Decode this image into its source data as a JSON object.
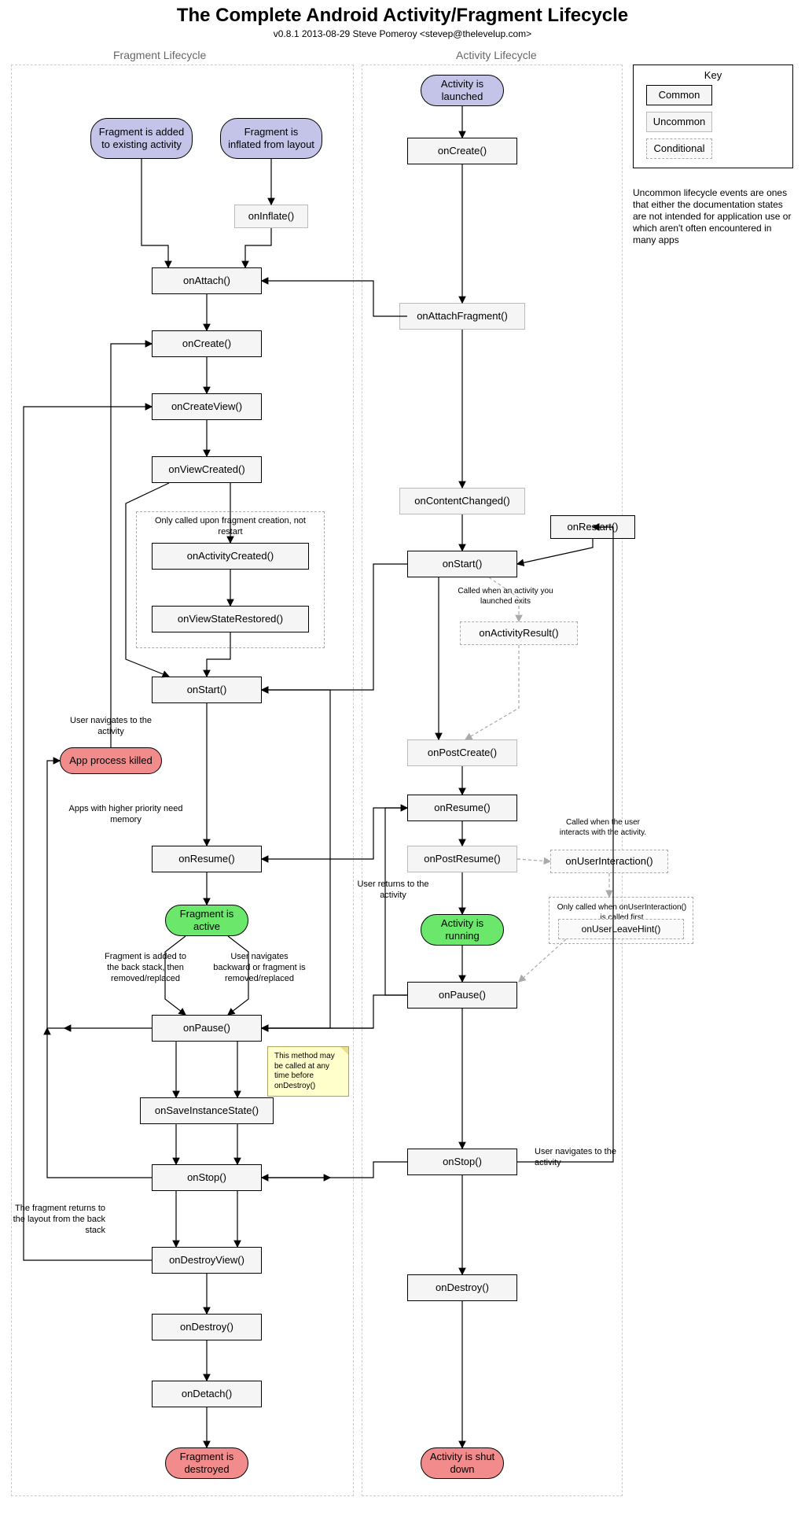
{
  "title": "The Complete Android Activity/Fragment Lifecycle",
  "subtitle": "v0.8.1 2013-08-29 Steve Pomeroy <stevep@thelevelup.com>",
  "regions": {
    "fragment": "Fragment Lifecycle",
    "activity": "Activity Lifecycle"
  },
  "key": {
    "title": "Key",
    "common": "Common",
    "uncommon": "Uncommon",
    "conditional": "Conditional",
    "note": "Uncommon lifecycle events are ones that either the documentation states are not intended for application use or which aren't often encountered in many apps"
  },
  "frag": {
    "added": "Fragment is added to existing activity",
    "inflated": "Fragment is inflated from layout",
    "onInflate": "onInflate()",
    "onAttach": "onAttach()",
    "onCreate": "onCreate()",
    "onCreateView": "onCreateView()",
    "onViewCreated": "onViewCreated()",
    "creationNote": "Only called upon fragment creation, not restart",
    "onActivityCreated": "onActivityCreated()",
    "onViewStateRestored": "onViewStateRestored()",
    "onStart": "onStart()",
    "navToActivity": "User navigates to the activity",
    "killed": "App process killed",
    "needMemory": "Apps with higher priority need memory",
    "onResume": "onResume()",
    "active": "Fragment is active",
    "pauseLeft": "Fragment is added to the back stack, then removed/replaced",
    "pauseRight": "User navigates backward or fragment is removed/replaced",
    "onPause": "onPause()",
    "onSaveInstanceState": "onSaveInstanceState()",
    "saveNote": "This method may be called at any time before onDestroy()",
    "onStop": "onStop()",
    "backStackNote": "The fragment returns to the layout from the back stack",
    "onDestroyView": "onDestroyView()",
    "onDestroy": "onDestroy()",
    "onDetach": "onDetach()",
    "destroyed": "Fragment is destroyed"
  },
  "act": {
    "launched": "Activity is launched",
    "onCreate": "onCreate()",
    "onAttachFragment": "onAttachFragment()",
    "onContentChanged": "onContentChanged()",
    "onRestart": "onRestart()",
    "onStart": "onStart()",
    "resultNote": "Called when an activity you launched exits",
    "onActivityResult": "onActivityResult()",
    "onPostCreate": "onPostCreate()",
    "onResume": "onResume()",
    "onPostResume": "onPostResume()",
    "userReturns": "User returns to the activity",
    "running": "Activity is running",
    "uiNote": "Called when the user interacts with the activity.",
    "onUserInteraction": "onUserInteraction()",
    "leaveNote": "Only called when onUserInteraction() is called first",
    "onUserLeaveHint": "onUserLeaveHint()",
    "onPause": "onPause()",
    "onStop": "onStop()",
    "stopNav": "User navigates to the activity",
    "onDestroy": "onDestroy()",
    "shutdown": "Activity is shut down"
  },
  "chart_data": {
    "type": "flowchart",
    "title": "The Complete Android Activity/Fragment Lifecycle",
    "lanes": [
      {
        "name": "Fragment Lifecycle"
      },
      {
        "name": "Activity Lifecycle"
      }
    ],
    "node_kinds": [
      "start",
      "common",
      "uncommon",
      "conditional",
      "running",
      "terminal"
    ],
    "nodes": [
      {
        "id": "f_added",
        "lane": 0,
        "kind": "start",
        "label": "Fragment is added to existing activity"
      },
      {
        "id": "f_inflated",
        "lane": 0,
        "kind": "start",
        "label": "Fragment is inflated from layout"
      },
      {
        "id": "f_onInflate",
        "lane": 0,
        "kind": "uncommon",
        "label": "onInflate()"
      },
      {
        "id": "f_onAttach",
        "lane": 0,
        "kind": "common",
        "label": "onAttach()"
      },
      {
        "id": "f_onCreate",
        "lane": 0,
        "kind": "common",
        "label": "onCreate()"
      },
      {
        "id": "f_onCreateView",
        "lane": 0,
        "kind": "common",
        "label": "onCreateView()"
      },
      {
        "id": "f_onViewCreated",
        "lane": 0,
        "kind": "common",
        "label": "onViewCreated()"
      },
      {
        "id": "f_onActivityCreated",
        "lane": 0,
        "kind": "common",
        "label": "onActivityCreated()",
        "group": "fragment_creation_only"
      },
      {
        "id": "f_onViewStateRestored",
        "lane": 0,
        "kind": "common",
        "label": "onViewStateRestored()",
        "group": "fragment_creation_only"
      },
      {
        "id": "f_onStart",
        "lane": 0,
        "kind": "common",
        "label": "onStart()"
      },
      {
        "id": "f_killed",
        "lane": 0,
        "kind": "terminal",
        "label": "App process killed"
      },
      {
        "id": "f_onResume",
        "lane": 0,
        "kind": "common",
        "label": "onResume()"
      },
      {
        "id": "f_active",
        "lane": 0,
        "kind": "running",
        "label": "Fragment is active"
      },
      {
        "id": "f_onPause",
        "lane": 0,
        "kind": "common",
        "label": "onPause()"
      },
      {
        "id": "f_onSave",
        "lane": 0,
        "kind": "common",
        "label": "onSaveInstanceState()"
      },
      {
        "id": "f_onStop",
        "lane": 0,
        "kind": "common",
        "label": "onStop()"
      },
      {
        "id": "f_onDestroyView",
        "lane": 0,
        "kind": "common",
        "label": "onDestroyView()"
      },
      {
        "id": "f_onDestroy",
        "lane": 0,
        "kind": "common",
        "label": "onDestroy()"
      },
      {
        "id": "f_onDetach",
        "lane": 0,
        "kind": "common",
        "label": "onDetach()"
      },
      {
        "id": "f_destroyed",
        "lane": 0,
        "kind": "terminal",
        "label": "Fragment is destroyed"
      },
      {
        "id": "a_launched",
        "lane": 1,
        "kind": "start",
        "label": "Activity is launched"
      },
      {
        "id": "a_onCreate",
        "lane": 1,
        "kind": "common",
        "label": "onCreate()"
      },
      {
        "id": "a_onAttachFragment",
        "lane": 1,
        "kind": "uncommon",
        "label": "onAttachFragment()"
      },
      {
        "id": "a_onContentChanged",
        "lane": 1,
        "kind": "uncommon",
        "label": "onContentChanged()"
      },
      {
        "id": "a_onRestart",
        "lane": 1,
        "kind": "common",
        "label": "onRestart()"
      },
      {
        "id": "a_onStart",
        "lane": 1,
        "kind": "common",
        "label": "onStart()"
      },
      {
        "id": "a_onActivityResult",
        "lane": 1,
        "kind": "conditional",
        "label": "onActivityResult()",
        "note": "Called when an activity you launched exits"
      },
      {
        "id": "a_onPostCreate",
        "lane": 1,
        "kind": "uncommon",
        "label": "onPostCreate()"
      },
      {
        "id": "a_onResume",
        "lane": 1,
        "kind": "common",
        "label": "onResume()"
      },
      {
        "id": "a_onPostResume",
        "lane": 1,
        "kind": "uncommon",
        "label": "onPostResume()"
      },
      {
        "id": "a_running",
        "lane": 1,
        "kind": "running",
        "label": "Activity is running"
      },
      {
        "id": "a_onUserInteraction",
        "lane": 1,
        "kind": "conditional",
        "label": "onUserInteraction()",
        "note": "Called when the user interacts with the activity."
      },
      {
        "id": "a_onUserLeaveHint",
        "lane": 1,
        "kind": "conditional",
        "label": "onUserLeaveHint()",
        "note": "Only called when onUserInteraction() is called first"
      },
      {
        "id": "a_onPause",
        "lane": 1,
        "kind": "common",
        "label": "onPause()"
      },
      {
        "id": "a_onStop",
        "lane": 1,
        "kind": "common",
        "label": "onStop()"
      },
      {
        "id": "a_onDestroy",
        "lane": 1,
        "kind": "common",
        "label": "onDestroy()"
      },
      {
        "id": "a_shutdown",
        "lane": 1,
        "kind": "terminal",
        "label": "Activity is shut down"
      }
    ],
    "groups": [
      {
        "id": "fragment_creation_only",
        "label": "Only called upon fragment creation, not restart"
      }
    ],
    "edges": [
      {
        "from": "f_added",
        "to": "f_onAttach"
      },
      {
        "from": "f_inflated",
        "to": "f_onInflate"
      },
      {
        "from": "f_onInflate",
        "to": "f_onAttach"
      },
      {
        "from": "f_onAttach",
        "to": "f_onCreate"
      },
      {
        "from": "f_onAttach",
        "to": "a_onAttachFragment"
      },
      {
        "from": "f_onCreate",
        "to": "f_onCreateView"
      },
      {
        "from": "f_onCreateView",
        "to": "f_onViewCreated"
      },
      {
        "from": "f_onViewCreated",
        "to": "f_onActivityCreated"
      },
      {
        "from": "f_onViewCreated",
        "to": "f_onStart",
        "bypass": true
      },
      {
        "from": "f_onActivityCreated",
        "to": "f_onViewStateRestored"
      },
      {
        "from": "f_onViewStateRestored",
        "to": "f_onStart"
      },
      {
        "from": "f_onStart",
        "to": "f_onResume"
      },
      {
        "from": "f_killed",
        "to": "f_onCreate",
        "label": "User navigates to the activity"
      },
      {
        "from": "f_onPause",
        "to": "f_killed",
        "label": "Apps with higher priority need memory"
      },
      {
        "from": "f_onStop",
        "to": "f_killed"
      },
      {
        "from": "f_onResume",
        "to": "f_active"
      },
      {
        "from": "f_active",
        "to": "f_onPause",
        "label_left": "Fragment is added to the back stack, then removed/replaced",
        "label_right": "User navigates backward or fragment is removed/replaced"
      },
      {
        "from": "f_onPause",
        "to": "f_onSave"
      },
      {
        "from": "f_onPause",
        "to": "f_onStart",
        "back": true
      },
      {
        "from": "f_onSave",
        "to": "f_onStop"
      },
      {
        "from": "f_onStop",
        "to": "f_onDestroyView"
      },
      {
        "from": "f_onStop",
        "to": "f_onStart",
        "back": true
      },
      {
        "from": "f_onDestroyView",
        "to": "f_onCreateView",
        "back": true,
        "label": "The fragment returns to the layout from the back stack"
      },
      {
        "from": "f_onDestroyView",
        "to": "f_onDestroy"
      },
      {
        "from": "f_onDestroy",
        "to": "f_onDetach"
      },
      {
        "from": "f_onDetach",
        "to": "f_destroyed"
      },
      {
        "from": "a_launched",
        "to": "a_onCreate"
      },
      {
        "from": "a_onCreate",
        "to": "a_onAttachFragment"
      },
      {
        "from": "a_onAttachFragment",
        "to": "a_onContentChanged"
      },
      {
        "from": "a_onContentChanged",
        "to": "a_onStart"
      },
      {
        "from": "a_onRestart",
        "to": "a_onStart"
      },
      {
        "from": "a_onStart",
        "to": "a_onActivityResult",
        "conditional": true
      },
      {
        "from": "a_onActivityResult",
        "to": "a_onPostCreate",
        "conditional": true
      },
      {
        "from": "a_onStart",
        "to": "a_onPostCreate"
      },
      {
        "from": "a_onPostCreate",
        "to": "a_onResume"
      },
      {
        "from": "a_onResume",
        "to": "a_onPostResume"
      },
      {
        "from": "a_onResume",
        "to": "f_onResume"
      },
      {
        "from": "a_onPostResume",
        "to": "a_running"
      },
      {
        "from": "a_running",
        "to": "a_onUserInteraction",
        "conditional": true
      },
      {
        "from": "a_onUserInteraction",
        "to": "a_onUserLeaveHint",
        "conditional": true
      },
      {
        "from": "a_onUserLeaveHint",
        "to": "a_onPause",
        "conditional": true
      },
      {
        "from": "a_running",
        "to": "a_onPause"
      },
      {
        "from": "a_onPause",
        "to": "a_onResume",
        "back": true,
        "label": "User returns to the activity"
      },
      {
        "from": "a_onPause",
        "to": "f_onPause"
      },
      {
        "from": "a_onPause",
        "to": "a_onStop"
      },
      {
        "from": "a_onStart",
        "to": "f_onStart"
      },
      {
        "from": "a_onStop",
        "to": "a_onRestart",
        "back": true,
        "label": "User navigates to the activity"
      },
      {
        "from": "a_onStop",
        "to": "f_onStop"
      },
      {
        "from": "a_onStop",
        "to": "a_onDestroy"
      },
      {
        "from": "a_onDestroy",
        "to": "a_shutdown"
      }
    ]
  }
}
